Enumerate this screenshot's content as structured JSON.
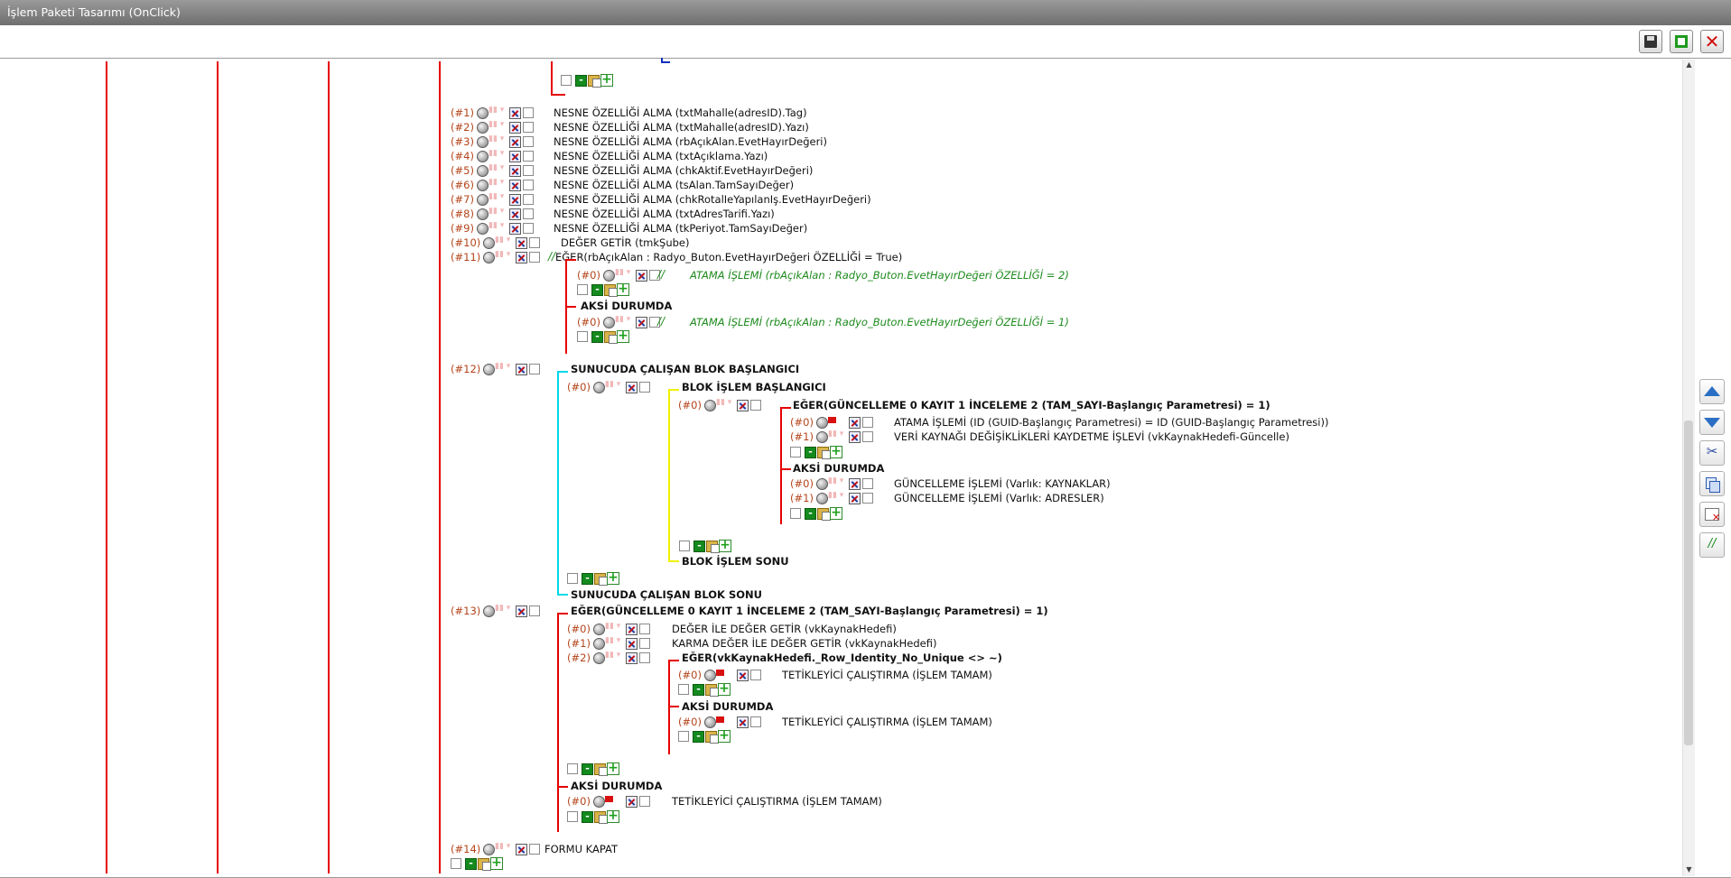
{
  "window": {
    "title": "İşlem Paketi Tasarımı (OnClick)"
  },
  "toolbar": {
    "save": "floppy-disk-icon",
    "save_close": "save-green-icon",
    "close": "close-x-icon"
  },
  "side_toolbar": [
    "move-up-icon",
    "move-down-icon",
    "cut-icon",
    "copy-icon",
    "delete-icon",
    "comment-icon"
  ],
  "colors": {
    "tree_line_red": "#e60000",
    "tree_line_cyan": "#00d8e8",
    "tree_line_yellow": "#f0f000",
    "tree_line_blue": "#1030c0",
    "index": "#b4441a",
    "comment_green": "#1d8a1d"
  },
  "tree": {
    "n01": {
      "idx": "(#1)",
      "label": "NESNE ÖZELLİĞİ ALMA (txtMahalle(adresID).Tag)"
    },
    "n02": {
      "idx": "(#2)",
      "label": "NESNE ÖZELLİĞİ ALMA (txtMahalle(adresID).Yazı)"
    },
    "n03": {
      "idx": "(#3)",
      "label": "NESNE ÖZELLİĞİ ALMA (rbAçıkAlan.EvetHayırDeğeri)"
    },
    "n04": {
      "idx": "(#4)",
      "label": "NESNE ÖZELLİĞİ ALMA (txtAçıklama.Yazı)"
    },
    "n05": {
      "idx": "(#5)",
      "label": "NESNE ÖZELLİĞİ ALMA (chkAktif.EvetHayırDeğeri)"
    },
    "n06": {
      "idx": "(#6)",
      "label": "NESNE ÖZELLİĞİ ALMA (tsAlan.TamSayıDeğer)"
    },
    "n07": {
      "idx": "(#7)",
      "label": "NESNE ÖZELLİĞİ ALMA (chkRotalIeYapılanIş.EvetHayırDeğeri)"
    },
    "n08": {
      "idx": "(#8)",
      "label": "NESNE ÖZELLİĞİ ALMA (txtAdresTarifi.Yazı)"
    },
    "n09": {
      "idx": "(#9)",
      "label": "NESNE ÖZELLİĞİ ALMA (tkPeriyot.TamSayıDeğer)"
    },
    "n10": {
      "idx": "(#10)",
      "label": "DEĞER GETİR (tmkŞube)"
    },
    "n11": {
      "idx": "(#11)",
      "comment": "//",
      "label": "EĞER(rbAçıkAlan : Radyo_Buton.EvetHayırDeğeri ÖZELLİĞİ = True)"
    },
    "n11a": {
      "idx": "(#0)",
      "comment": "//",
      "label": "ATAMA İŞLEMİ (rbAçıkAlan : Radyo_Buton.EvetHayırDeğeri ÖZELLİĞİ = 2)"
    },
    "n11else": {
      "label": "AKSİ DURUMDA"
    },
    "n11b": {
      "idx": "(#0)",
      "comment": "//",
      "label": "ATAMA İŞLEMİ (rbAçıkAlan : Radyo_Buton.EvetHayırDeğeri ÖZELLİĞİ = 1)"
    },
    "n12": {
      "idx": "(#12)",
      "label": "SUNUCUDA ÇALIŞAN BLOK BAŞLANGICI"
    },
    "n12a": {
      "idx": "(#0)",
      "label": "BLOK İŞLEM BAŞLANGICI"
    },
    "n12b": {
      "idx": "(#0)",
      "label": "EĞER(GÜNCELLEME 0 KAYIT 1 İNCELEME 2 (TAM_SAYI-Başlangıç Parametresi) = 1)"
    },
    "n12c": {
      "idx": "(#0)",
      "label": "ATAMA İŞLEMİ (ID (GUID-Başlangıç Parametresi) = ID (GUID-Başlangıç Parametresi))"
    },
    "n12d": {
      "idx": "(#1)",
      "label": "VERİ KAYNAĞI DEĞİŞİKLİKLERİ KAYDETME İŞLEVİ (vkKaynakHedefi-Güncelle)"
    },
    "n12else": {
      "label": "AKSİ DURUMDA"
    },
    "n12e": {
      "idx": "(#0)",
      "label": "GÜNCELLEME İŞLEMİ (Varlık: KAYNAKLAR)"
    },
    "n12f": {
      "idx": "(#1)",
      "label": "GÜNCELLEME İŞLEMİ (Varlık: ADRESLER)"
    },
    "n12end1": {
      "label": "BLOK İŞLEM SONU"
    },
    "n12end2": {
      "label": "SUNUCUDA ÇALIŞAN BLOK SONU"
    },
    "n13": {
      "idx": "(#13)",
      "label": "EĞER(GÜNCELLEME 0 KAYIT 1 İNCELEME 2 (TAM_SAYI-Başlangıç Parametresi) = 1)"
    },
    "n13a": {
      "idx": "(#0)",
      "label": "DEĞER İLE DEĞER GETİR (vkKaynakHedefi)"
    },
    "n13b": {
      "idx": "(#1)",
      "label": "KARMA DEĞER İLE DEĞER GETİR (vkKaynakHedefi)"
    },
    "n13c": {
      "idx": "(#2)",
      "label": "EĞER(vkKaynakHedefi._Row_Identity_No_Unique <> ~)"
    },
    "n13d": {
      "idx": "(#0)",
      "label": "TETİKLEYİCİ ÇALIŞTIRMA (İŞLEM TAMAM)"
    },
    "n13else1": {
      "label": "AKSİ DURUMDA"
    },
    "n13e": {
      "idx": "(#0)",
      "label": "TETİKLEYİCİ ÇALIŞTIRMA (İŞLEM TAMAM)"
    },
    "n13else2": {
      "label": "AKSİ DURUMDA"
    },
    "n13f": {
      "idx": "(#0)",
      "label": "TETİKLEYİCİ ÇALIŞTIRMA (İŞLEM TAMAM)"
    },
    "n14": {
      "idx": "(#14)",
      "label": "FORMU KAPAT"
    }
  }
}
